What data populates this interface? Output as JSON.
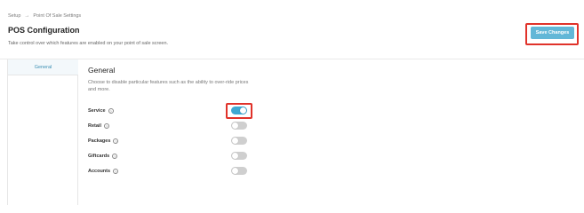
{
  "breadcrumb": {
    "parent": "Setup",
    "separator": "→",
    "current": "Point Of Sale Settings"
  },
  "header": {
    "title": "POS Configuration",
    "description": "Take control over which features are enabled on your point of sale screen.",
    "save_label": "Save Changes"
  },
  "sidebar": {
    "items": [
      {
        "label": "General",
        "active": true
      }
    ]
  },
  "section": {
    "title": "General",
    "description": "Choose to disable particular features such as the ability to over-ride prices and more."
  },
  "features": [
    {
      "label": "Service",
      "enabled": true,
      "icon": "info-icon"
    },
    {
      "label": "Retail",
      "enabled": false,
      "icon": "info-icon"
    },
    {
      "label": "Packages",
      "enabled": false,
      "icon": "info-icon"
    },
    {
      "label": "Giftcards",
      "enabled": false,
      "icon": "info-icon"
    },
    {
      "label": "Accounts",
      "enabled": false,
      "icon": "info-icon"
    }
  ],
  "colors": {
    "accent": "#3ea8d2",
    "save_button": "#62b7d7",
    "highlight": "#e0322a",
    "toggle_off": "#cfcfcf"
  }
}
